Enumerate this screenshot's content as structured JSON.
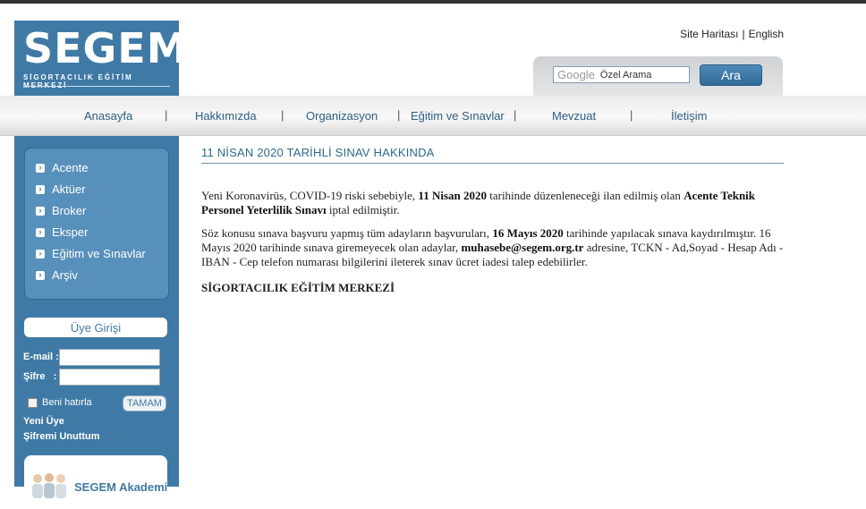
{
  "logo": {
    "word": "SEGEM",
    "tagline": "SİGORTACILIK EĞİTİM MERKEZİ"
  },
  "toplinks": {
    "sitemap": "Site Haritası",
    "separator": "|",
    "english": "English"
  },
  "search": {
    "brand": "Google",
    "placeholder": "Özel Arama",
    "button": "Ara"
  },
  "nav": {
    "items": [
      "Anasayfa",
      "Hakkımızda",
      "Organizasyon",
      "Eğitim ve Sınavlar",
      "Mevzuat",
      "İletişim"
    ],
    "separator": "|"
  },
  "sidebar": {
    "menu": [
      "Acente",
      "Aktüer",
      "Broker",
      "Eksper",
      "Eğitim ve Sınavlar",
      "Arşiv"
    ],
    "login": {
      "header": "Üye Girişi",
      "email_label": "E-mail :",
      "password_label": "Şifre   :",
      "remember": "Beni hatırla",
      "submit": "TAMAM",
      "new_member": "Yeni Üye",
      "forgot": "Şifremi Unuttum"
    },
    "promo": {
      "text": "SEGEM Akademi"
    }
  },
  "content": {
    "title": "11 NİSAN 2020 TARİHLİ SINAV HAKKINDA",
    "p1": {
      "a": "Yeni Koronavirüs, COVID-19 riski sebebiyle, ",
      "b": "11 Nisan 2020",
      "c": " tarihinde düzenleneceği ilan edilmiş olan ",
      "d": "Acente Teknik Personel Yeterlilik Sınavı",
      "e": " iptal edilmiştir."
    },
    "p2": {
      "a": "Söz konusu sınava başvuru yapmış tüm adayların başvuruları, ",
      "b": "16 Mayıs 2020",
      "c": " tarihinde yapılacak sınava kaydırılmıştır. 16 Mayıs 2020 tarihinde sınava giremeyecek olan adaylar, ",
      "d": "muhasebe@segem.org.tr",
      "e": " adresine, TCKN - Ad,Soyad - Hesap Adı - IBAN - Cep telefon numarası bilgilerini ileterek sınav ücret iadesi talep edebilirler."
    },
    "signature": "SİGORTACILIK EĞİTİM MERKEZİ"
  },
  "colors": {
    "brand_blue": "#3f7aa6",
    "menu_blue": "#5790bb",
    "link_blue": "#2b5d85"
  }
}
